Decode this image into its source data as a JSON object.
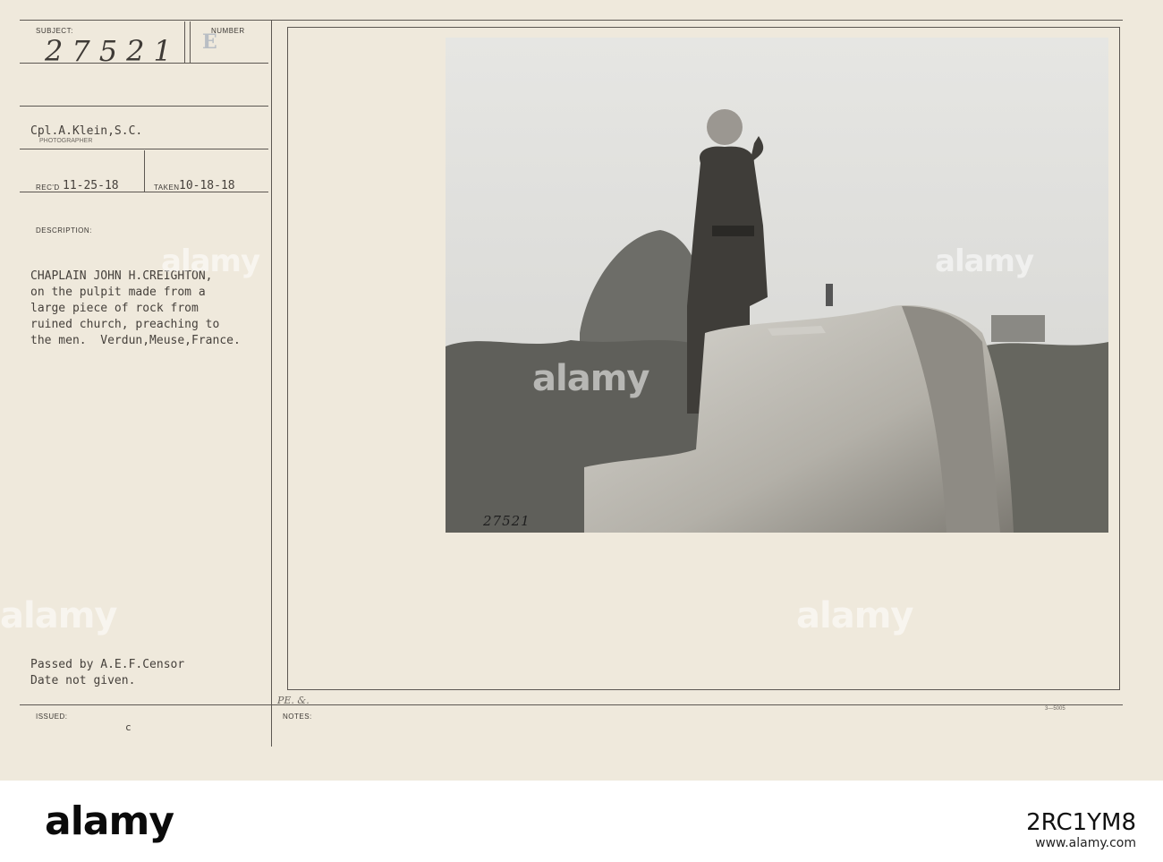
{
  "card": {
    "subject_label": "SUBJECT:",
    "number_label": "NUMBER",
    "subject_number": "27521",
    "number_letter": "E",
    "photographer": "Cpl.A.Klein,S.C.",
    "photographer_label": "PHOTOGRAPHER",
    "recd_label": "REC'D",
    "recd_date": "11-25-18",
    "taken_label": "TAKEN",
    "taken_date": "10-18-18",
    "description_label": "DESCRIPTION:",
    "description_lines": [
      "CHAPLAIN JOHN H.CREIGHTON,",
      "on the pulpit made from a",
      "large piece of rock from",
      "ruined church, preaching to",
      "the men.  Verdun,Meuse,France."
    ],
    "censor_lines": [
      "Passed by A.E.F.Censor",
      "Date not given."
    ],
    "issued_label": "ISSUED:",
    "issued_mark": "c",
    "notes_label": "NOTES:",
    "pe_mark": "PE. &.",
    "form_number": "3—5005",
    "negative_number": "27521"
  },
  "photo": {
    "caption": "Chaplain preaching from a rock pulpit"
  },
  "watermark": {
    "text": "alamy"
  },
  "stock_bar": {
    "logo": "alamy",
    "image_id": "2RC1YM8",
    "site": "www.alamy.com"
  }
}
